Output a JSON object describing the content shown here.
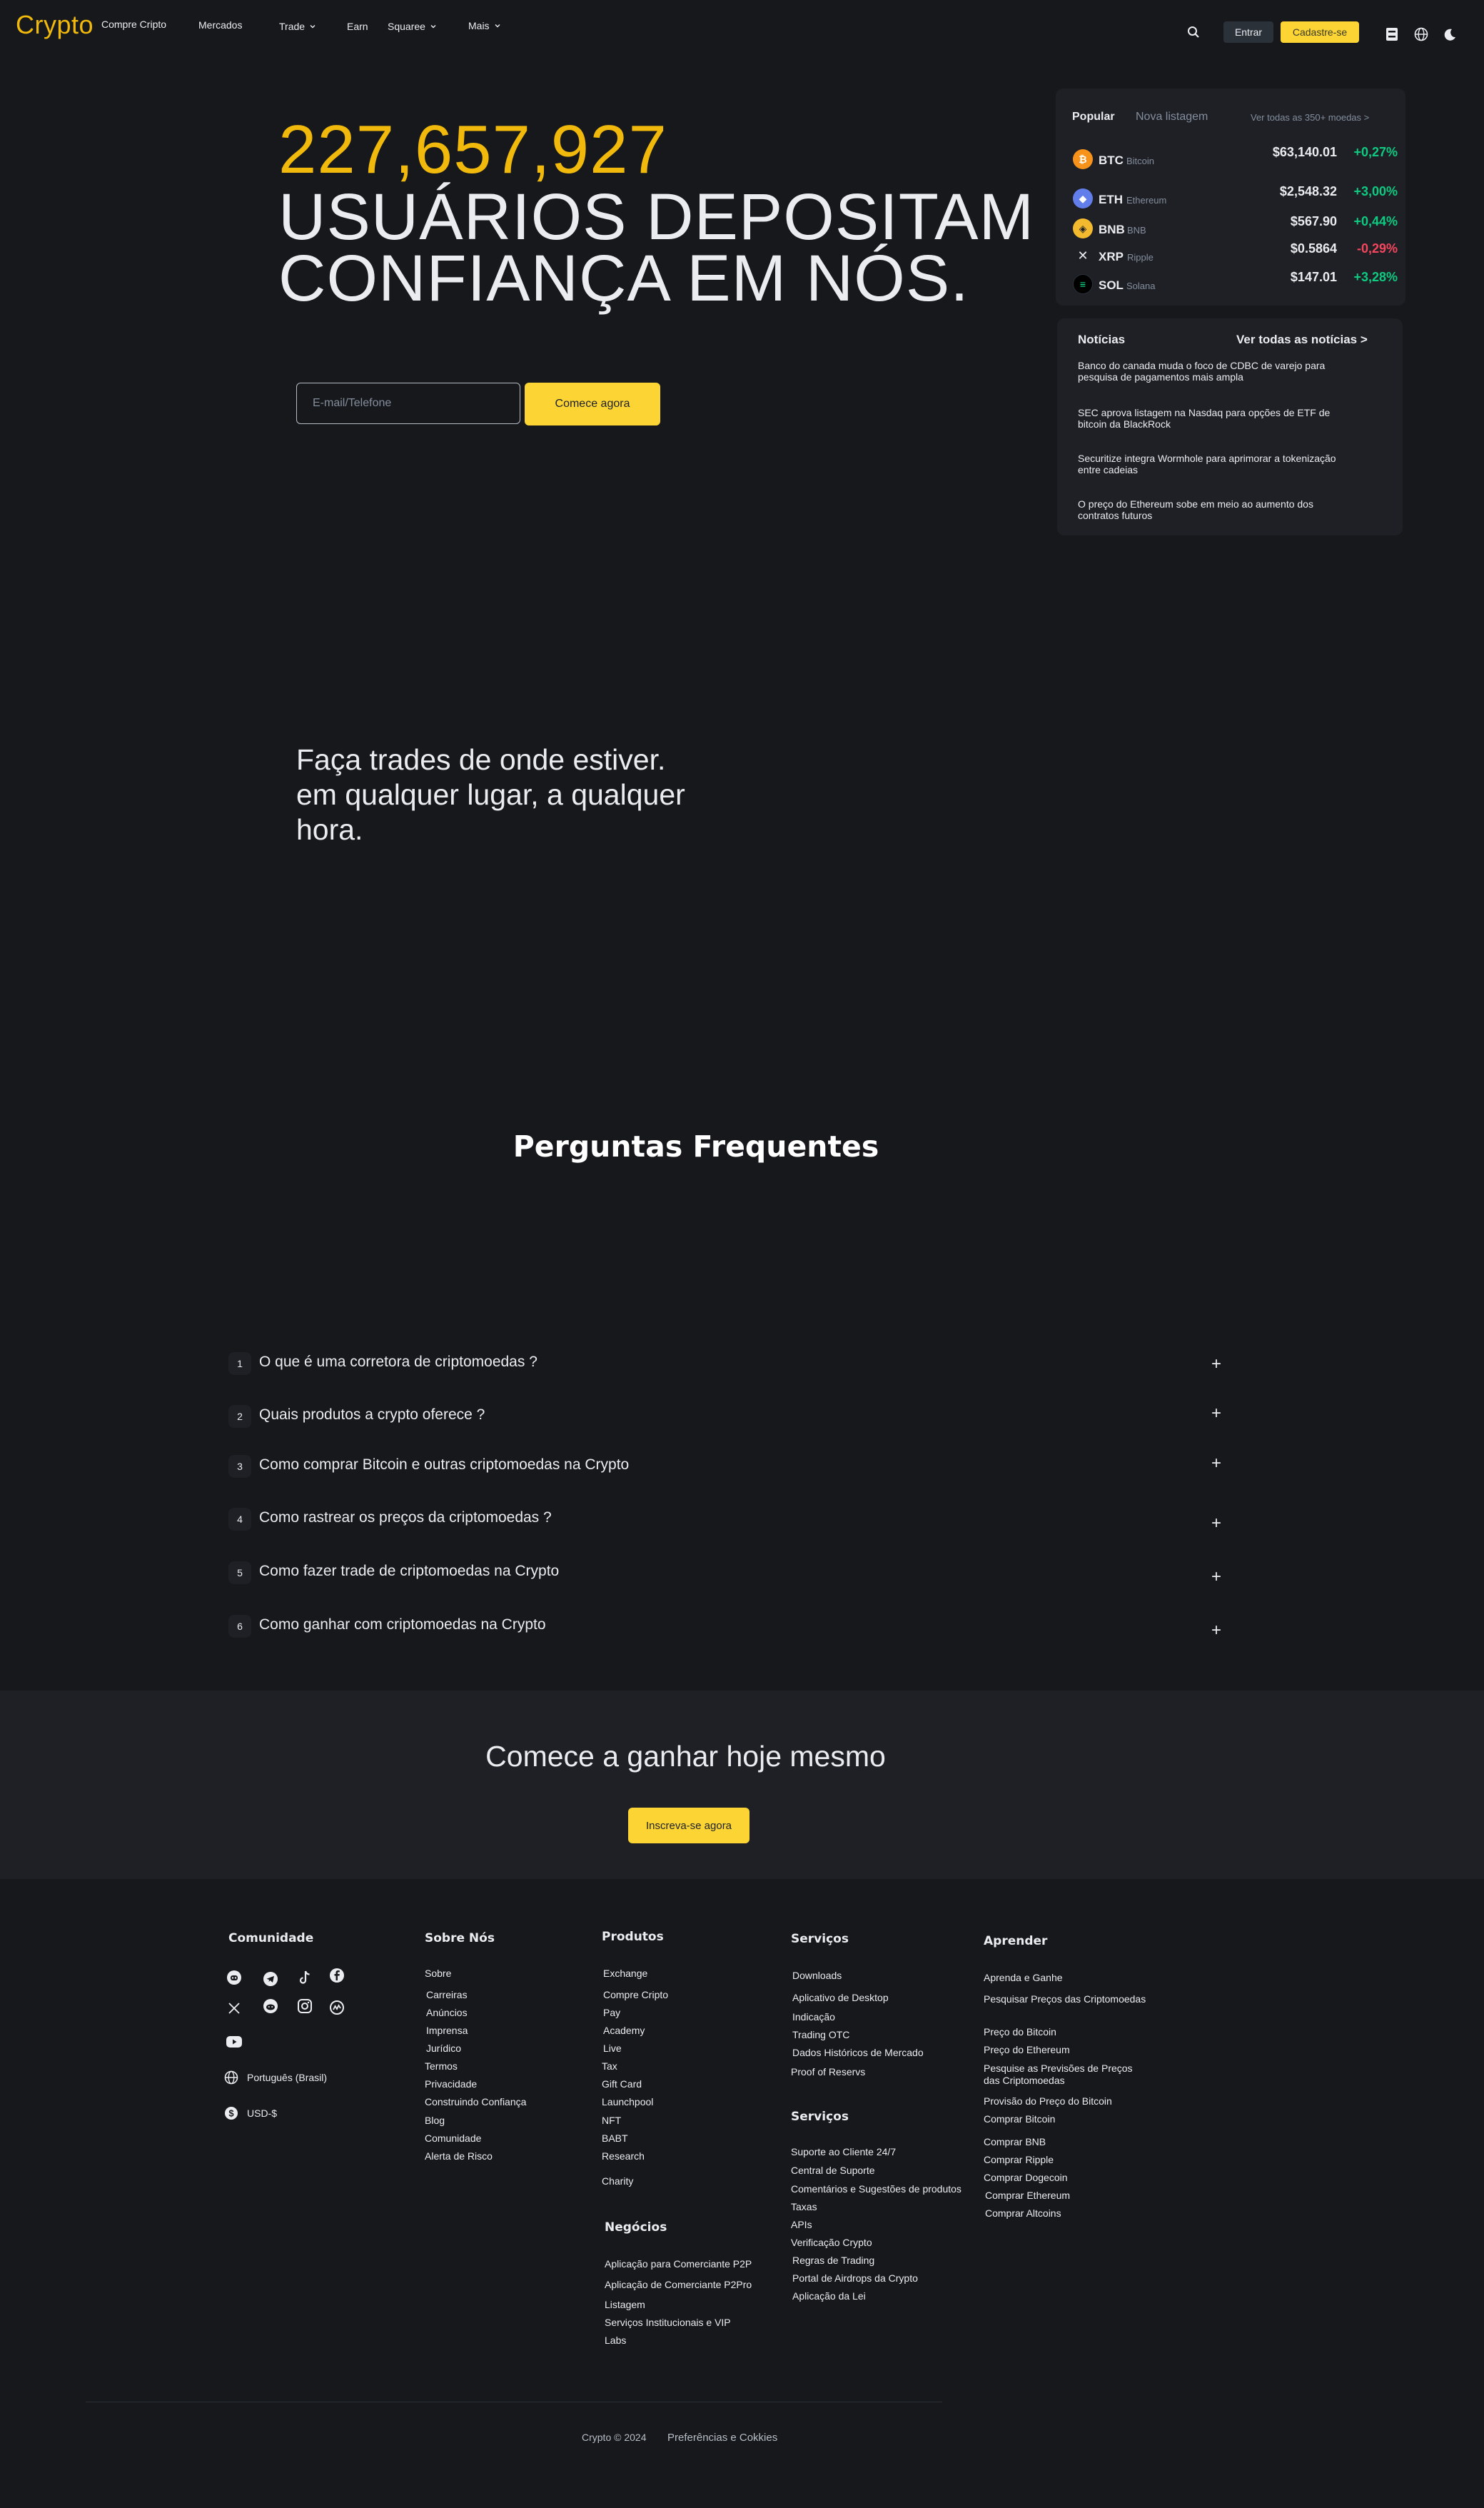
{
  "brand": {
    "logo": "Crypto",
    "accent": "#f0b90b",
    "up_color": "#0ecb81",
    "down_color": "#f6465d"
  },
  "nav": {
    "items": [
      {
        "label": "Compre Cripto",
        "dropdown": false
      },
      {
        "label": "Mercados",
        "dropdown": false
      },
      {
        "label": "Trade",
        "dropdown": true
      },
      {
        "label": "Earn",
        "dropdown": false
      },
      {
        "label": "Squaree",
        "dropdown": true
      },
      {
        "label": "Mais",
        "dropdown": true
      }
    ],
    "login": "Entrar",
    "signup": "Cadastre-se",
    "icons": [
      "search-icon",
      "download-icon",
      "globe-icon",
      "moon-icon"
    ]
  },
  "hero": {
    "count": "227,657,927",
    "line1": "USUÁRIOS DEPOSITAM",
    "line2": "CONFIANÇA EM NÓS.",
    "email_placeholder": "E-mail/Telefone",
    "start_button": "Comece agora"
  },
  "market": {
    "tabs": [
      "Popular",
      "Nova listagem"
    ],
    "view_all": "Ver todas as 350+ moedas >",
    "coins": [
      {
        "symbol": "BTC",
        "name": "Bitcoin",
        "price": "$63,140.01",
        "change": "+0,27%",
        "direction": "up",
        "color": "#f7931a",
        "glyph": "₿"
      },
      {
        "symbol": "ETH",
        "name": "Ethereum",
        "price": "$2,548.32",
        "change": "+3,00%",
        "direction": "up",
        "color": "#627eea",
        "glyph": "◆"
      },
      {
        "symbol": "BNB",
        "name": "BNB",
        "price": "$567.90",
        "change": "+0,44%",
        "direction": "up",
        "color": "#f3ba2f",
        "glyph": "◈"
      },
      {
        "symbol": "XRP",
        "name": "Ripple",
        "price": "$0.5864",
        "change": "-0,29%",
        "direction": "down",
        "color": "#23292f",
        "glyph": "✕"
      },
      {
        "symbol": "SOL",
        "name": "Solana",
        "price": "$147.01",
        "change": "+3,28%",
        "direction": "up",
        "color": "#000000",
        "glyph": "≡"
      }
    ]
  },
  "news": {
    "title": "Notícias",
    "view_all": "Ver todas as notícias >",
    "items": [
      {
        "line1": "Banco do canada muda o foco de CDBC de varejo para",
        "line2": "pesquisa de pagamentos mais ampla"
      },
      {
        "line1": "SEC aprova listagem na Nasdaq para opções de ETF de",
        "line2": "bitcoin da BlackRock"
      },
      {
        "line1": "Securitize integra Wormhole para aprimorar a tokenização",
        "line2": "entre cadeias"
      },
      {
        "line1": "O preço do Ethereum sobe em meio ao aumento dos",
        "line2": "contratos futuros"
      }
    ]
  },
  "trade_anywhere": {
    "line1": "Faça trades de onde estiver.",
    "line2": "em qualquer lugar, a qualquer",
    "line3": "hora."
  },
  "faq": {
    "title": "Perguntas Frequentes",
    "items": [
      {
        "num": "1",
        "question": "O que é uma corretora de criptomoedas ?"
      },
      {
        "num": "2",
        "question": "Quais produtos a crypto oferece ?"
      },
      {
        "num": "3",
        "question": "Como comprar Bitcoin e outras criptomoedas na Crypto"
      },
      {
        "num": "4",
        "question": "Como rastrear os preços da criptomoedas ?"
      },
      {
        "num": "5",
        "question": "Como fazer trade de criptomoedas na Crypto"
      },
      {
        "num": "6",
        "question": "Como ganhar com criptomoedas na Crypto"
      }
    ]
  },
  "cta": {
    "title": "Comece a ganhar hoje mesmo",
    "button": "Inscreva-se agora"
  },
  "footer": {
    "community": {
      "title": "Comunidade",
      "socials": [
        "discord-icon",
        "telegram-icon",
        "tiktok-icon",
        "facebook-icon",
        "x-icon",
        "reddit-icon",
        "instagram-icon",
        "coinmarketcap-icon",
        "youtube-icon"
      ],
      "language": "Português (Brasil)",
      "currency": "USD-$"
    },
    "about": {
      "title": "Sobre Nós",
      "links": [
        "Sobre",
        "Carreiras",
        "Anúncios",
        "Imprensa",
        "Jurídico",
        "Termos",
        "Privacidade",
        "Construindo Confiança",
        "Blog",
        "Comunidade",
        "Alerta de Risco"
      ]
    },
    "products": {
      "title": "Produtos",
      "links": [
        "Exchange",
        "Compre Cripto",
        "Pay",
        "Academy",
        "Live",
        "Tax",
        "Gift Card",
        "Launchpool",
        "NFT",
        "BABT",
        "Research",
        "Charity"
      ]
    },
    "business": {
      "title": "Negócios",
      "links": [
        "Aplicação para Comerciante P2P",
        "Aplicação de Comerciante P2Pro",
        "Listagem",
        "Serviços Institucionais e VIP",
        "Labs"
      ]
    },
    "services": {
      "title": "Serviços",
      "links": [
        "Downloads",
        "Aplicativo de Desktop",
        "Indicação",
        "Trading OTC",
        "Dados Históricos de Mercado",
        "Proof of Reservs"
      ]
    },
    "services2": {
      "title": "Serviços",
      "links": [
        "Suporte ao Cliente 24/7",
        "Central de Suporte",
        "Comentários e Sugestões de produtos",
        "Taxas",
        "APIs",
        "Verificação Crypto",
        "Regras de Trading",
        "Portal de Airdrops da Crypto",
        "Aplicação da Lei"
      ]
    },
    "learn": {
      "title": "Aprender",
      "links": [
        "Aprenda e Ganhe",
        "Pesquisar Preços das Criptomoedas",
        "Preço do Bitcoin",
        "Preço do Ethereum",
        "Pesquise as Previsões de Preços das Criptomoedas",
        "Provisão do Preço do Bitcoin",
        "Comprar Bitcoin",
        "Comprar BNB",
        "Comprar Ripple",
        "Comprar Dogecoin",
        "Comprar Ethereum",
        "Comprar Altcoins"
      ]
    },
    "copyright": "Crypto © 2024",
    "cookies": "Preferências e Cokkies"
  }
}
